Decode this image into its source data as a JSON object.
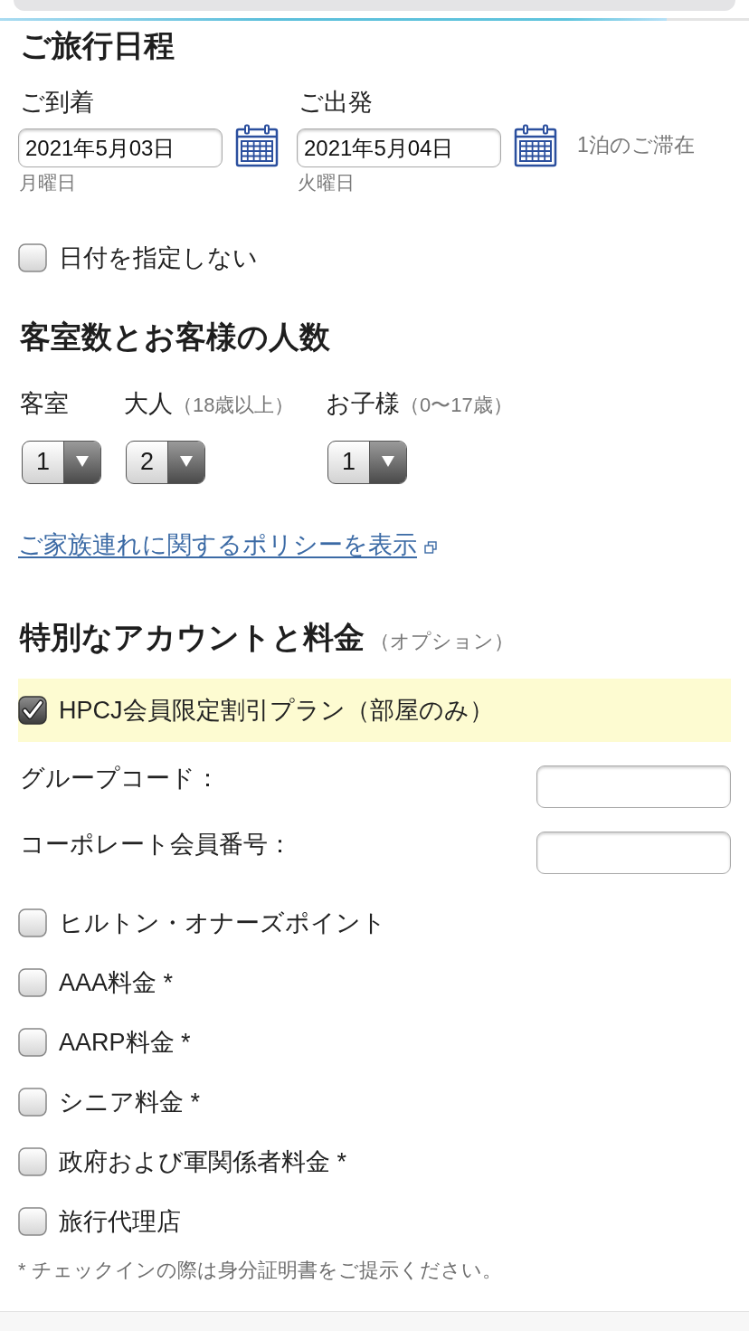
{
  "browser": {
    "loading_bar": {
      "level": 0.89
    }
  },
  "itinerary": {
    "title": "ご旅行日程",
    "dates": [
      {
        "label": "ご到着",
        "value": "2021年5月03日",
        "weekday": "月曜日"
      },
      {
        "label": "ご出発",
        "value": "2021年5月04日",
        "weekday": "火曜日"
      }
    ],
    "stay": "1泊のご滞在"
  },
  "flexible_dates": {
    "label": "日付を指定しない",
    "checked": false
  },
  "rooms_guests": {
    "title": "客室数とお客様の人数",
    "selectors": [
      {
        "label": "客室",
        "value": "1"
      },
      {
        "label": "大人",
        "note": "（18歳以上）",
        "value": "2"
      },
      {
        "label": "お子様",
        "note": "（0〜17歳）",
        "value": "1"
      }
    ],
    "policy_link": "ご家族連れに関するポリシーを表示"
  },
  "special_rates": {
    "title": "特別なアカウントと料金",
    "note": "（オプション）",
    "items": [
      {
        "kind": "checkbox",
        "label": "HPCJ会員限定割引プラン（部屋のみ）",
        "checked": true
      },
      {
        "kind": "text_field",
        "label": "グループコード："
      },
      {
        "kind": "text_field",
        "label": "コーポレート会員番号："
      },
      {
        "kind": "checkbox",
        "label": "ヒルトン・オナーズポイント",
        "checked": false
      },
      {
        "kind": "checkbox",
        "label": "AAA料金 *",
        "checked": false
      },
      {
        "kind": "checkbox",
        "label": "AARP料金 *",
        "checked": false
      },
      {
        "kind": "checkbox",
        "label": "シニア料金 *",
        "checked": false
      },
      {
        "kind": "checkbox",
        "label": "政府および軍関係者料金 *",
        "checked": false
      },
      {
        "kind": "checkbox",
        "label": "旅行代理店",
        "checked": false
      }
    ],
    "footnote": "* チェックインの際は身分証明書をご提示ください。"
  }
}
